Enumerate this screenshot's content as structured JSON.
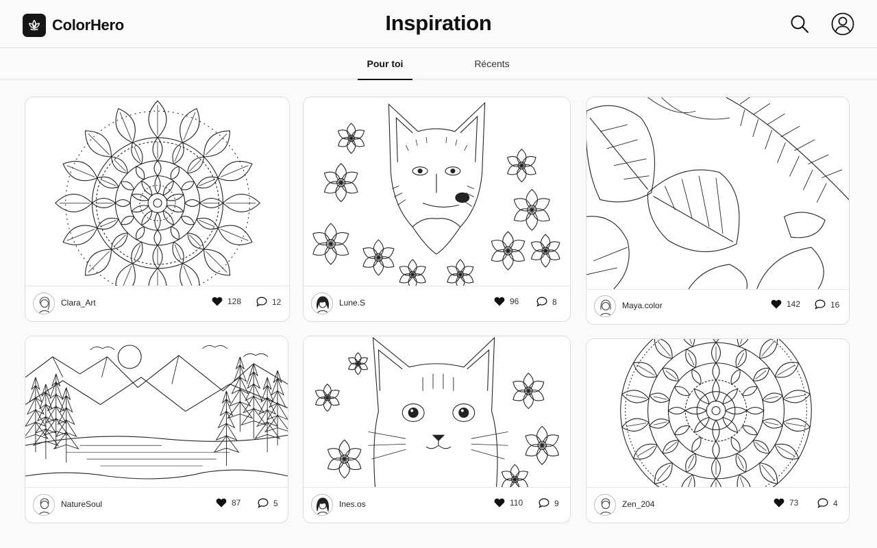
{
  "app": {
    "name": "ColorHero",
    "logo_icon": "lotus-icon"
  },
  "page": {
    "title": "Inspiration"
  },
  "header": {
    "search_icon": "search-icon",
    "profile_icon": "user-circle-icon"
  },
  "tabs": [
    {
      "label": "Pour toi",
      "active": true
    },
    {
      "label": "Récents",
      "active": false
    }
  ],
  "posts": [
    {
      "author": "Clara_Art",
      "likes": "128",
      "comments": "12",
      "artwork": "mandala"
    },
    {
      "author": "Lune.S",
      "likes": "96",
      "comments": "8",
      "artwork": "fox-with-flowers"
    },
    {
      "author": "Maya.color",
      "likes": "142",
      "comments": "16",
      "artwork": "tropical-leaves"
    },
    {
      "author": "NatureSoul",
      "likes": "87",
      "comments": "5",
      "artwork": "mountain-lake-landscape"
    },
    {
      "author": "Ines.os",
      "likes": "110",
      "comments": "9",
      "artwork": "cat-with-flowers"
    },
    {
      "author": "Zen_204",
      "likes": "73",
      "comments": "4",
      "artwork": "circular-mandala"
    }
  ],
  "colors": {
    "background": "#fafafa",
    "ink": "#111111",
    "border": "#dcdcdc"
  }
}
